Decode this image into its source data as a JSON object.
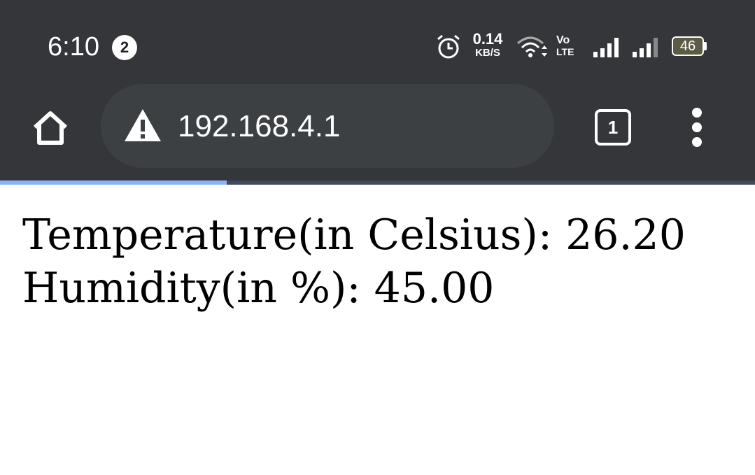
{
  "status_bar": {
    "time": "6:10",
    "notification_count": "2",
    "net_speed_value": "0.14",
    "net_speed_unit": "KB/S",
    "volte_top": "Vo",
    "volte_bottom": "LTE",
    "battery": "46",
    "icons": [
      "alarm-icon",
      "wifi-icon",
      "signal-sim1-icon",
      "signal-sim2-icon",
      "battery-icon"
    ]
  },
  "browser": {
    "url": "192.168.4.1",
    "tab_count": "1",
    "icons": [
      "home-icon",
      "warning-icon",
      "tabs-icon",
      "menu-icon"
    ],
    "progress_fraction": 0.3
  },
  "page": {
    "lines": [
      "Temperature(in Celsius): 26.20",
      "Humidity(in %): 45.00"
    ]
  },
  "colors": {
    "chrome_bg": "#35363a",
    "url_bar_bg": "#3c4043",
    "progress": "#8ab4f8"
  }
}
